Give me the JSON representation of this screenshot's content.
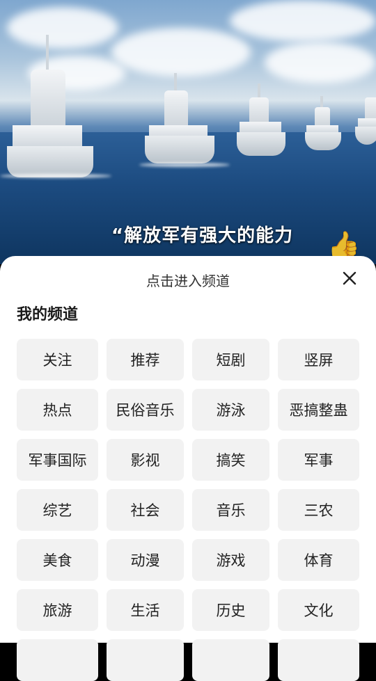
{
  "video": {
    "subtitle": "“解放军有强大的能力"
  },
  "sheet": {
    "title": "点击进入频道",
    "section_label": "我的频道",
    "channels": [
      "关注",
      "推荐",
      "短剧",
      "竖屏",
      "热点",
      "民俗音乐",
      "游泳",
      "恶搞整蛊",
      "军事国际",
      "影视",
      "搞笑",
      "军事",
      "综艺",
      "社会",
      "音乐",
      "三农",
      "美食",
      "动漫",
      "游戏",
      "体育",
      "旅游",
      "生活",
      "历史",
      "文化"
    ]
  },
  "colors": {
    "chip_background": "#f2f2f2",
    "sheet_background": "#ffffff"
  }
}
